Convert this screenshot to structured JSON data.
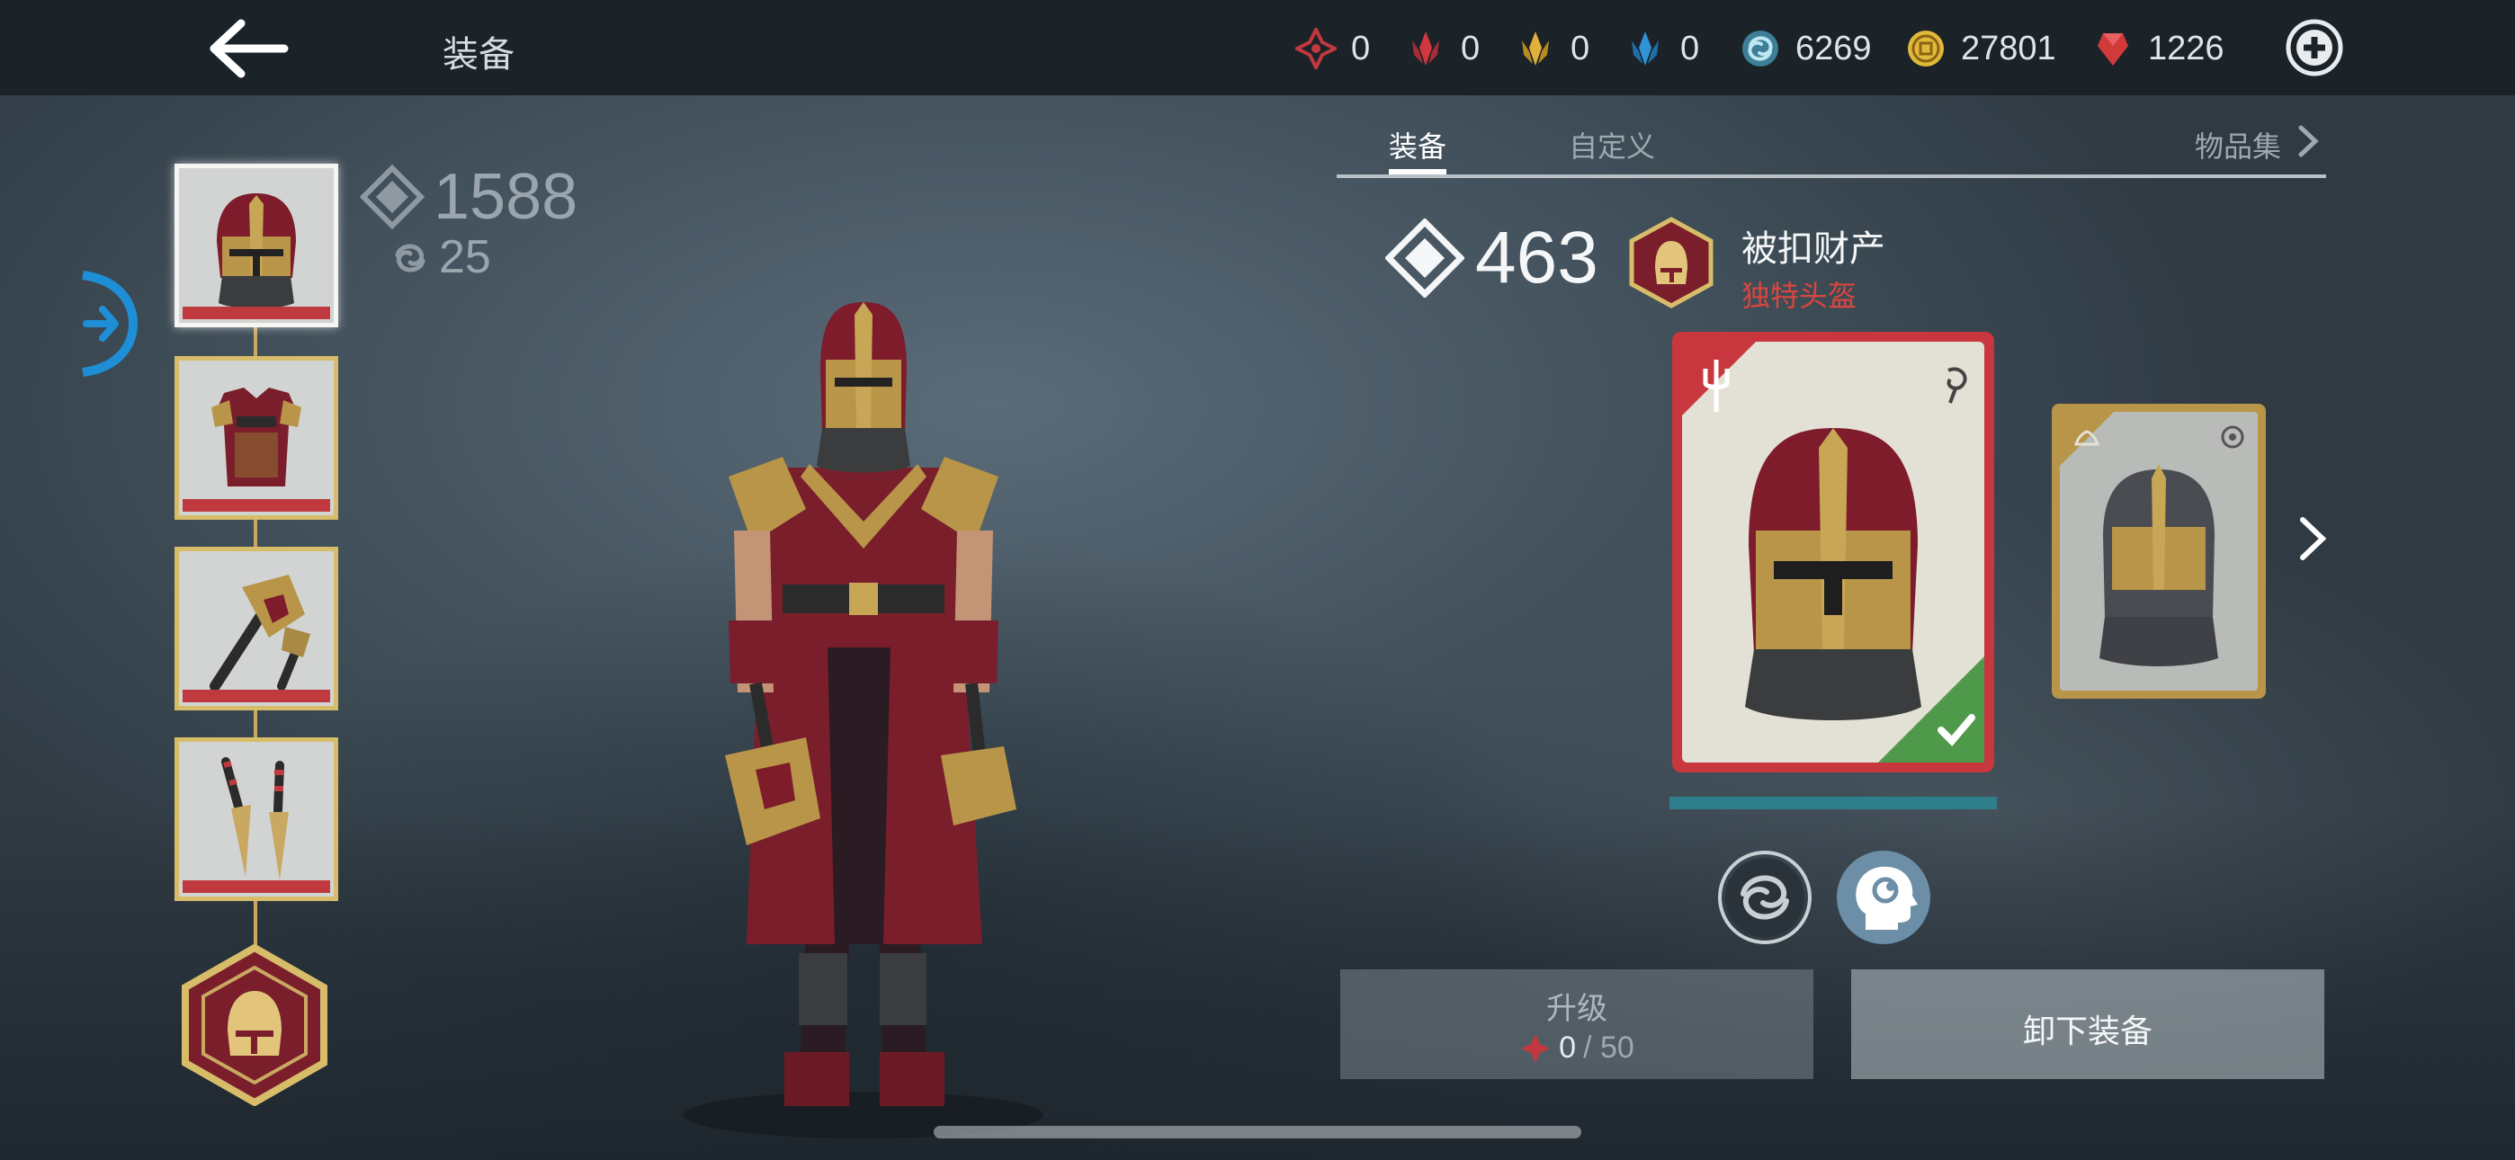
{
  "header": {
    "back_icon": "back-arrow-icon",
    "title": "装备",
    "currencies": [
      {
        "name": "red-star-shard",
        "icon": "red-star-icon",
        "value": "0",
        "color": "#c0393f"
      },
      {
        "name": "red-crystal",
        "icon": "red-crystal-icon",
        "value": "0",
        "color": "#c0393f"
      },
      {
        "name": "gold-crystal",
        "icon": "gold-crystal-icon",
        "value": "0",
        "color": "#d7a83a"
      },
      {
        "name": "blue-crystal",
        "icon": "blue-crystal-icon",
        "value": "0",
        "color": "#2f93d6"
      },
      {
        "name": "spiral-energy",
        "icon": "spiral-icon",
        "value": "6269",
        "color": "#7fc6e0"
      },
      {
        "name": "gold-coin",
        "icon": "coin-icon",
        "value": "27801",
        "color": "#e0b83a"
      },
      {
        "name": "ruby-gem",
        "icon": "ruby-icon",
        "value": "1226",
        "color": "#d13a3a"
      }
    ],
    "plus_icon": "plus-circle-icon"
  },
  "left": {
    "gear_score": "1588",
    "sub_stat": "25",
    "slots": [
      {
        "name": "helmet",
        "active": true
      },
      {
        "name": "armor",
        "active": false
      },
      {
        "name": "weapon",
        "active": false
      },
      {
        "name": "ranged",
        "active": false
      }
    ],
    "badge_icon": "helmet-badge-icon",
    "expand_icon": "expand-arrow-icon"
  },
  "right": {
    "tabs": {
      "equipment": "装备",
      "custom": "自定义",
      "collection": "物品集"
    },
    "item": {
      "gear_score": "463",
      "name": "被扣财产",
      "type": "独特头盔",
      "type_color": "#d9463f"
    },
    "upgrade": {
      "label": "升级",
      "have": "0",
      "need": "/ 50"
    },
    "unequip_label": "卸下装备"
  }
}
